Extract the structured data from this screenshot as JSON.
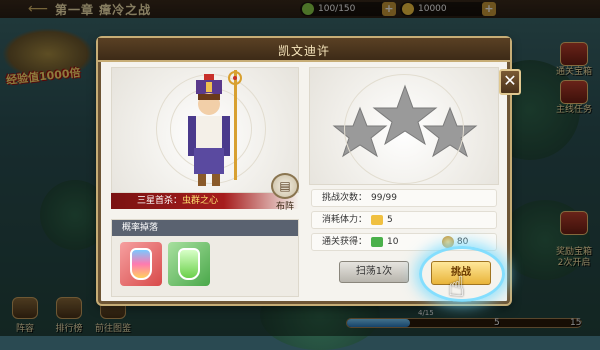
{
  "topbar": {
    "chapter_title": "第一章 瘴冷之战",
    "stamina": "100/150",
    "gold": "10000"
  },
  "left_banner": "经验值1000倍",
  "nav": [
    {
      "label": "阵容"
    },
    {
      "label": "排行榜"
    },
    {
      "label": "前往图鉴"
    }
  ],
  "side_buttons": [
    {
      "label": "通关宝箱"
    },
    {
      "label": "主线任务"
    },
    {
      "label": "奖励宝箱\n2次开启"
    }
  ],
  "progress": {
    "label": "4/15",
    "left_num": "5",
    "right_num": "15",
    "fraction": 0.27
  },
  "dialog": {
    "title": "凯文迪许",
    "close_label": "✕",
    "first_kill_label": "三星首杀：",
    "first_kill_value": "虫群之心",
    "formation_label": "布阵",
    "drop_header": "概率掉落",
    "stars_count": 3,
    "challenge_count_label": "挑战次数：",
    "challenge_count_value": "99/99",
    "stamina_cost_label": "消耗体力：",
    "stamina_cost_value": "5",
    "reward_label": "通关获得：",
    "reward_exp": "10",
    "reward_gold": "80",
    "sweep_label": "扫荡1次",
    "challenge_label": "挑战"
  },
  "colors": {
    "accent": "#e9b43a",
    "title_bar": "#3d2b17",
    "banner_red": "#a61d1d",
    "glow": "#78dcff"
  }
}
